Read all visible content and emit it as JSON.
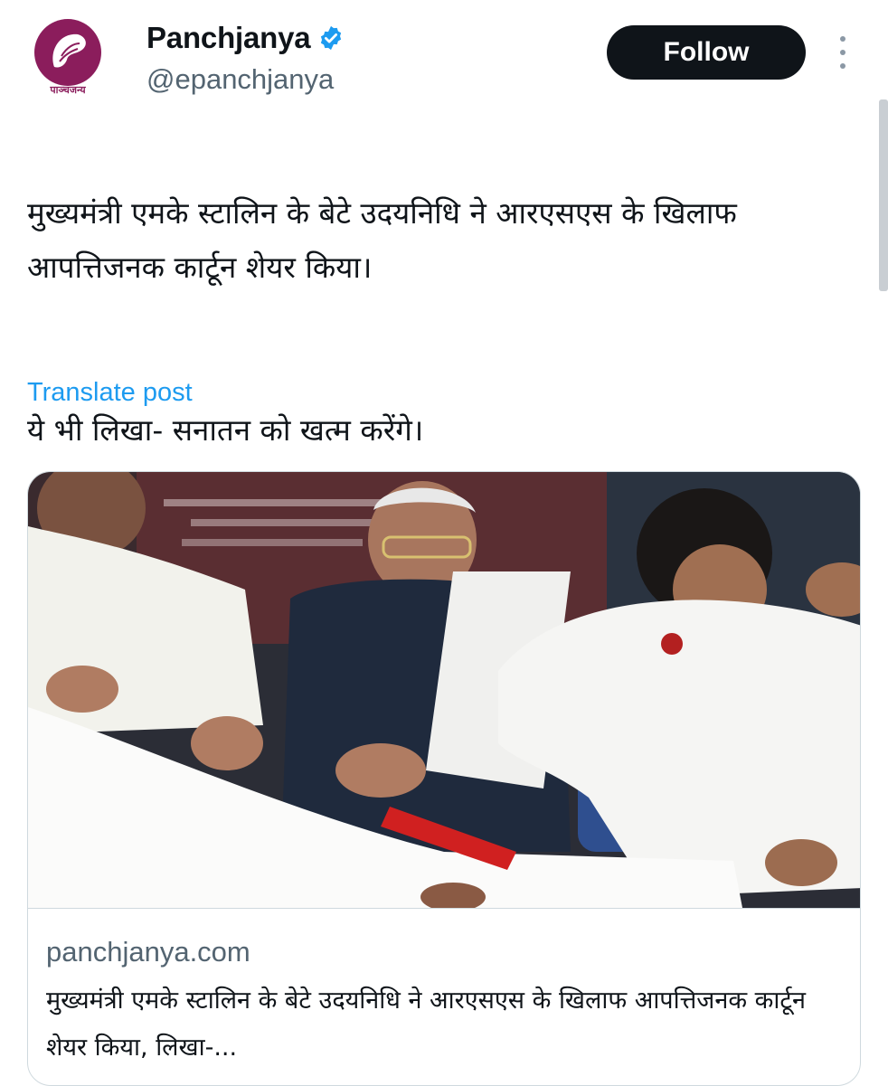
{
  "author": {
    "display_name": "Panchjanya",
    "handle": "@epanchjanya",
    "verified": true,
    "avatar_logo_text": "पाञ्चजन्य",
    "avatar_color": "#8b1d5c"
  },
  "actions": {
    "follow_label": "Follow",
    "more_icon": "more-dots-icon"
  },
  "tweet": {
    "paragraph_1": "मुख्यमंत्री एमके स्टालिन के बेटे उदयनिधि ने आरएसएस के खिलाफ आपत्तिजनक कार्टून शेयर किया।",
    "paragraph_2": "ये भी लिखा- सनातन को खत्म करेंगे।",
    "translate_label": "Translate post"
  },
  "link_card": {
    "domain": "panchjanya.com",
    "title": "मुख्यमंत्री एमके स्टालिन के बेटे उदयनिधि ने आरएसएस के खिलाफ आपत्तिजनक कार्टून शेयर किया, लिखा-..."
  },
  "colors": {
    "follow_bg": "#0f1419",
    "link_blue": "#1d9bf0",
    "verified_blue": "#1d9bf0",
    "secondary_text": "#536471",
    "border": "#cfd9de"
  }
}
